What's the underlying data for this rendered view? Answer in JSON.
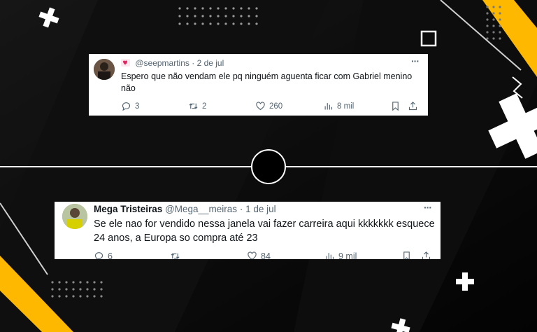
{
  "tweets": [
    {
      "display_name": "",
      "handle": "@seepmartins",
      "date": "2 de jul",
      "text": "Espero que não vendam ele pq ninguém aguenta ficar com Gabriel menino não",
      "replies": "3",
      "retweets": "2",
      "likes": "260",
      "views": "8 mil"
    },
    {
      "display_name": "Mega Tristeiras",
      "handle": "@Mega__meiras",
      "date": "1 de jul",
      "text": "Se ele nao for vendido nessa janela vai fazer carreira aqui kkkkkkk esquece 24 anos, a Europa so compra até 23",
      "replies": "6",
      "retweets": "",
      "likes": "84",
      "views": "9 mil"
    }
  ],
  "separator": "·",
  "more_glyph": "···",
  "colors": {
    "accent_yellow": "#FFB800",
    "background": "#070707",
    "muted": "#536471"
  },
  "icons": [
    "reply-icon",
    "retweet-icon",
    "like-icon",
    "views-icon",
    "bookmark-icon",
    "share-icon",
    "more-icon",
    "hearts-emoji-icon"
  ]
}
